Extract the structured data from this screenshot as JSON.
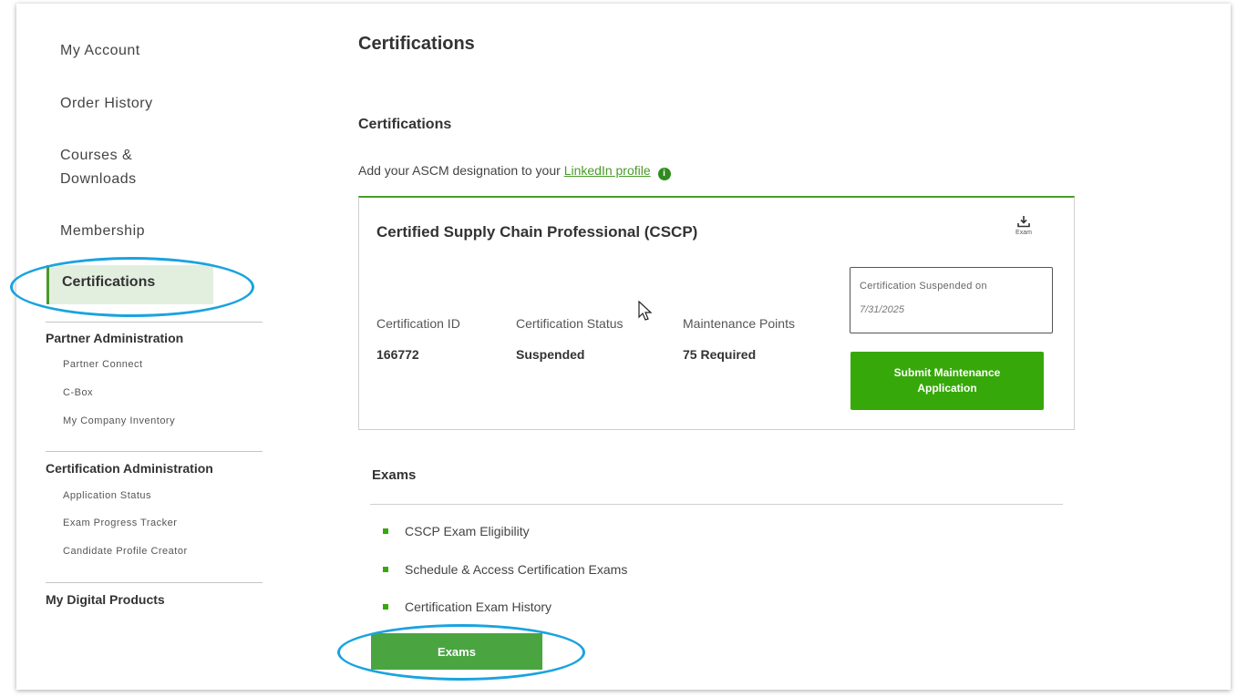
{
  "sidebar": {
    "items": [
      {
        "label": "My Account"
      },
      {
        "label": "Order History"
      },
      {
        "label": "Courses &\nDownloads"
      },
      {
        "label": "Membership"
      },
      {
        "label": "Certifications"
      }
    ],
    "partner_admin": {
      "heading": "Partner Administration",
      "items": [
        "Partner Connect",
        "C-Box",
        "My Company Inventory"
      ]
    },
    "cert_admin": {
      "heading": "Certification Administration",
      "items": [
        "Application Status",
        "Exam Progress Tracker",
        "Candidate Profile Creator"
      ]
    },
    "digital_products": "My Digital Products"
  },
  "main": {
    "page_title": "Certifications",
    "section_title": "Certifications",
    "intro_text": "Add your ASCM designation to your ",
    "intro_link": "LinkedIn profile",
    "info_icon": "info-icon"
  },
  "certification": {
    "title": "Certified Supply Chain Professional (CSCP)",
    "download_label": "Exam",
    "fields": [
      {
        "label": "Certification ID",
        "value": "166772"
      },
      {
        "label": "Certification Status",
        "value": "Suspended"
      },
      {
        "label": "Maintenance Points",
        "value": "75 Required"
      }
    ],
    "suspended_label": "Certification Suspended on",
    "suspended_date": "7/31/2025",
    "submit_label": "Submit Maintenance Application"
  },
  "exams": {
    "title": "Exams",
    "items": [
      "CSCP Exam Eligibility",
      "Schedule & Access Certification Exams",
      "Certification Exam History"
    ],
    "button_label": "Exams"
  },
  "colors": {
    "accent": "#4a9a2b",
    "button": "#37a80a",
    "annotation": "#1aa3e0"
  }
}
